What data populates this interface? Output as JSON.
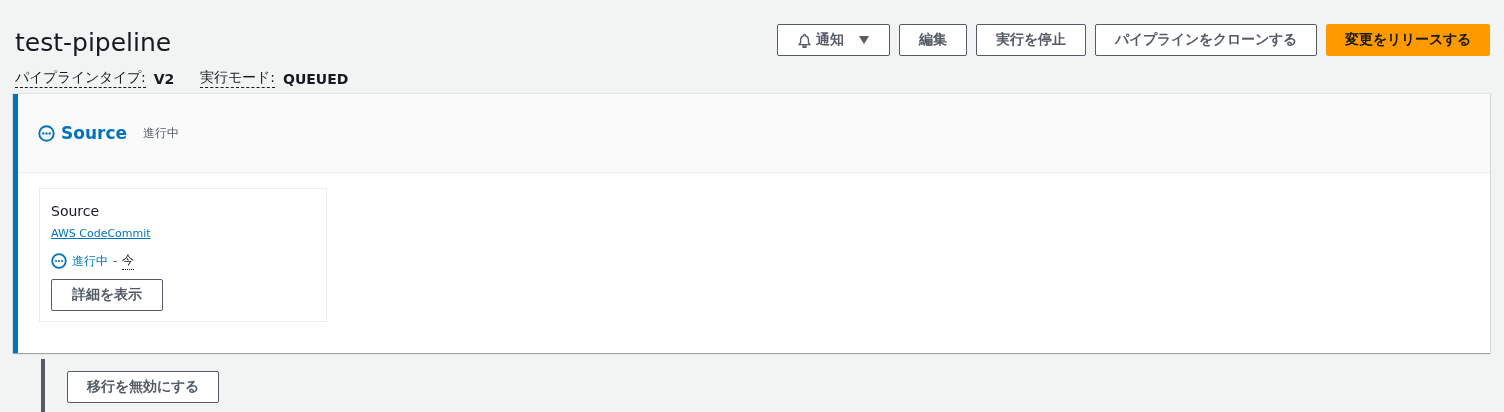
{
  "pipeline": {
    "name": "test-pipeline",
    "meta": [
      {
        "label": "パイプラインタイプ:",
        "value": "V2"
      },
      {
        "label": "実行モード:",
        "value": "QUEUED"
      }
    ]
  },
  "buttons": [
    {
      "label": "通知",
      "kind": "dropdown"
    },
    {
      "label": "編集",
      "kind": "normal"
    },
    {
      "label": "実行を停止",
      "kind": "normal"
    },
    {
      "label": "パイプラインをクローンする",
      "kind": "normal"
    },
    {
      "label": "変更をリリースする",
      "kind": "primary"
    }
  ],
  "stage": {
    "name": "Source",
    "status": "進行中",
    "kind": "in_progress",
    "actions": [
      {
        "name": "Source",
        "provider": "AWS CodeCommit",
        "status": "進行中",
        "separator": "-",
        "time": "今",
        "kind": "in_progress",
        "button": "詳細を表示"
      }
    ]
  },
  "transition": {
    "button": "移行を無効にする"
  }
}
